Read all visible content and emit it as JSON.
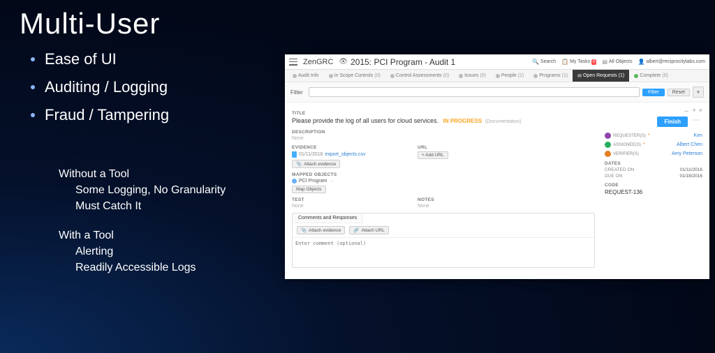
{
  "slide": {
    "heading": "Multi-User",
    "bullets": [
      "Ease of UI",
      "Auditing / Logging",
      "Fraud / Tampering"
    ],
    "without_hdr": "Without a Tool",
    "without_items": [
      "Some Logging, No Granularity",
      "Must Catch It"
    ],
    "with_hdr": "With a Tool",
    "with_items": [
      "Alerting",
      "Readily Accessible Logs"
    ]
  },
  "app": {
    "brand": "ZenGRC",
    "page_title": "2015: PCI Program - Audit 1",
    "toplinks": {
      "search": "Search",
      "mytasks": "My Tasks",
      "mytasks_badge": "0",
      "allobjects": "All Objects",
      "user": "albert@reciprocitylabs.com"
    },
    "tabs": [
      {
        "label": "Audit Info",
        "count": ""
      },
      {
        "label": "In Scope Controls",
        "count": "(0)"
      },
      {
        "label": "Control Assessments",
        "count": "(0)"
      },
      {
        "label": "Issues",
        "count": "(0)"
      },
      {
        "label": "People",
        "count": "(1)"
      },
      {
        "label": "Programs",
        "count": "(1)"
      },
      {
        "label": "Open Requests",
        "count": "(1)"
      },
      {
        "label": "Complete",
        "count": "(0)"
      }
    ],
    "filter": {
      "label": "Filter",
      "placeholder": "",
      "filter_btn": "Filter",
      "reset_btn": "Reset"
    },
    "request": {
      "title_label": "TITLE",
      "title_value": "Please provide the log of all users for cloud services.",
      "status": "IN PROGRESS",
      "status_note": "(Documentation)",
      "description_label": "DESCRIPTION",
      "description_value": "None",
      "evidence_label": "EVIDENCE",
      "evidence_date": "01/11/2016",
      "evidence_file": "export_objects.csv",
      "attach_evidence_btn": "Attach evidence",
      "url_label": "URL",
      "add_url_btn": "+ Add URL",
      "mapped_label": "MAPPED OBJECTS",
      "mapped_item": "PCI Program",
      "map_objects_btn": "Map Objects",
      "test_label": "TEST",
      "test_value": "None",
      "notes_label": "NOTES",
      "notes_value": "None",
      "comments_tab": "Comments and Responses",
      "attach_evidence_btn2": "Attach evidence",
      "attach_url_btn": "Attach URL",
      "comment_placeholder": "Enter comment (optional)"
    },
    "side": {
      "finish_btn": "Finish",
      "roles": [
        {
          "role": "REQUESTER(S)",
          "req": true,
          "avatar": "av-purple",
          "who": "Ken"
        },
        {
          "role": "ASSIGNEE(S)",
          "req": true,
          "avatar": "av-green",
          "who": "Albert Chen"
        },
        {
          "role": "VERIFIER(S)",
          "req": false,
          "avatar": "av-orange",
          "who": "Amy Peterson"
        }
      ],
      "dates_label": "DATES",
      "created_label": "CREATED ON",
      "created_value": "01/11/2016",
      "due_label": "DUE ON",
      "due_value": "01/18/2016",
      "code_label": "CODE",
      "code_value": "REQUEST-136"
    }
  }
}
